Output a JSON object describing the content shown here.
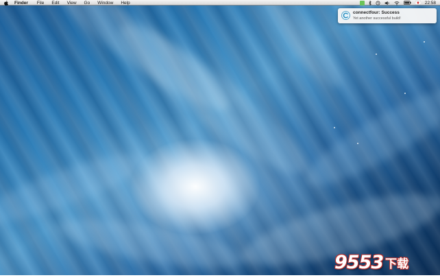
{
  "menubar": {
    "apple_icon": "apple-icon",
    "app_name": "Finder",
    "items": [
      "File",
      "Edit",
      "View",
      "Go",
      "Window",
      "Help"
    ],
    "status_icons": [
      "app-status-icon",
      "bluetooth-icon",
      "time-machine-icon",
      "volume-icon",
      "wifi-icon",
      "battery-icon",
      "flag-icon"
    ],
    "clock": "22:58",
    "accent_color": "#6dc35a"
  },
  "notification": {
    "icon": "circular-app-icon",
    "title": "connectfour: Success",
    "body": "Yet another successful build!"
  },
  "watermark": {
    "digits": "9553",
    "text": "下载"
  }
}
